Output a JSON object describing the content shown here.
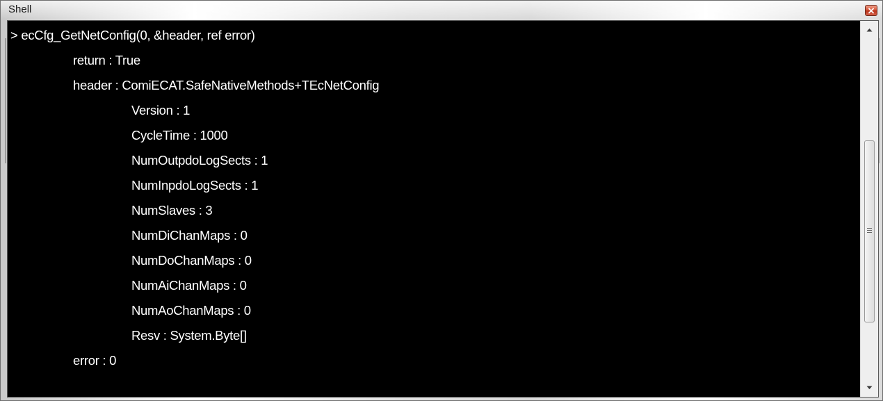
{
  "window": {
    "title": "Shell"
  },
  "icons": {
    "close": "close-icon",
    "scroll_up": "arrow-up-icon",
    "scroll_down": "arrow-down-icon",
    "grip": "grip-icon"
  },
  "colors": {
    "console_bg": "#000000",
    "console_text": "#ffffff",
    "close_button": "#c8452c"
  },
  "console": {
    "lines": [
      "> ecCfg_GetNetConfig(0, &header, ref error)",
      "return : True",
      "header : ComiECAT.SafeNativeMethods+TEcNetConfig",
      "Version : 1",
      "CycleTime : 1000",
      "NumOutpdoLogSects : 1",
      "NumInpdoLogSects : 1",
      "NumSlaves : 3",
      "NumDiChanMaps : 0",
      "NumDoChanMaps : 0",
      "NumAiChanMaps : 0",
      "NumAoChanMaps : 0",
      "Resv : System.Byte[]",
      "error : 0"
    ]
  }
}
